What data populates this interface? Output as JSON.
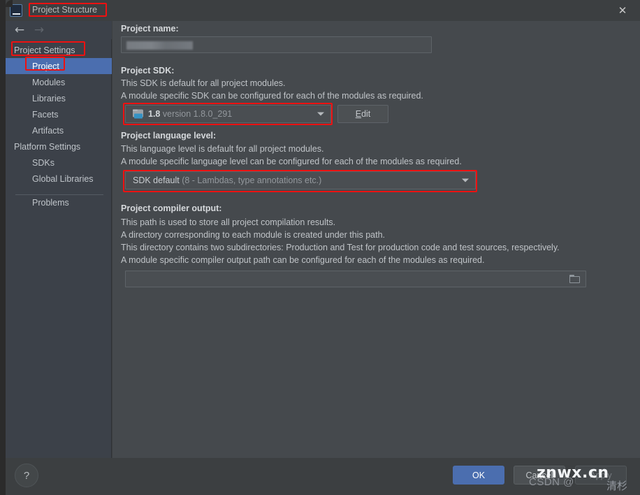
{
  "window": {
    "title": "Project Structure",
    "app_icon": "IJ",
    "close_icon": "✕",
    "back_icon": "←",
    "forward_icon": "→"
  },
  "sidebar": {
    "items": [
      {
        "label": "Project Settings",
        "type": "group",
        "selected": false
      },
      {
        "label": "Project",
        "type": "child",
        "selected": true
      },
      {
        "label": "Modules",
        "type": "child",
        "selected": false
      },
      {
        "label": "Libraries",
        "type": "child",
        "selected": false
      },
      {
        "label": "Facets",
        "type": "child",
        "selected": false
      },
      {
        "label": "Artifacts",
        "type": "child",
        "selected": false
      },
      {
        "label": "Platform Settings",
        "type": "group",
        "selected": false
      },
      {
        "label": "SDKs",
        "type": "child",
        "selected": false
      },
      {
        "label": "Global Libraries",
        "type": "child",
        "selected": false
      },
      {
        "label": "Problems",
        "type": "child",
        "selected": false
      }
    ]
  },
  "main": {
    "project_name": {
      "label": "Project name:",
      "value": "",
      "redacted": true
    },
    "project_sdk": {
      "label": "Project SDK:",
      "description": [
        "This SDK is default for all project modules.",
        "A module specific SDK can be configured for each of the modules as required."
      ],
      "selected_name": "1.8",
      "selected_detail": "version 1.8.0_291",
      "icon": "sdk-folder-icon",
      "edit_button": "Edit",
      "edit_mnemonic": "E"
    },
    "language_level": {
      "label": "Project language level:",
      "description": [
        "This language level is default for all project modules.",
        "A module specific language level can be configured for each of the modules as required."
      ],
      "selected_name": "SDK default",
      "selected_detail": "(8 - Lambdas, type annotations etc.)"
    },
    "compiler_output": {
      "label": "Project compiler output:",
      "description": [
        "This path is used to store all project compilation results.",
        "A directory corresponding to each module is created under this path.",
        "This directory contains two subdirectories: Production and Test for production code and test sources, respectively.",
        "A module specific compiler output path can be configured for each of the modules as required."
      ],
      "value": "",
      "browse_icon": "folder-browse-icon"
    }
  },
  "footer": {
    "help_icon": "?",
    "ok_label": "OK",
    "cancel_label": "Cancel",
    "apply_label": "Apply"
  },
  "watermark": {
    "primary": "znwx.cn",
    "secondary": "CSDN @",
    "chinese": "清杉"
  },
  "annotation_color": "#ee1111"
}
